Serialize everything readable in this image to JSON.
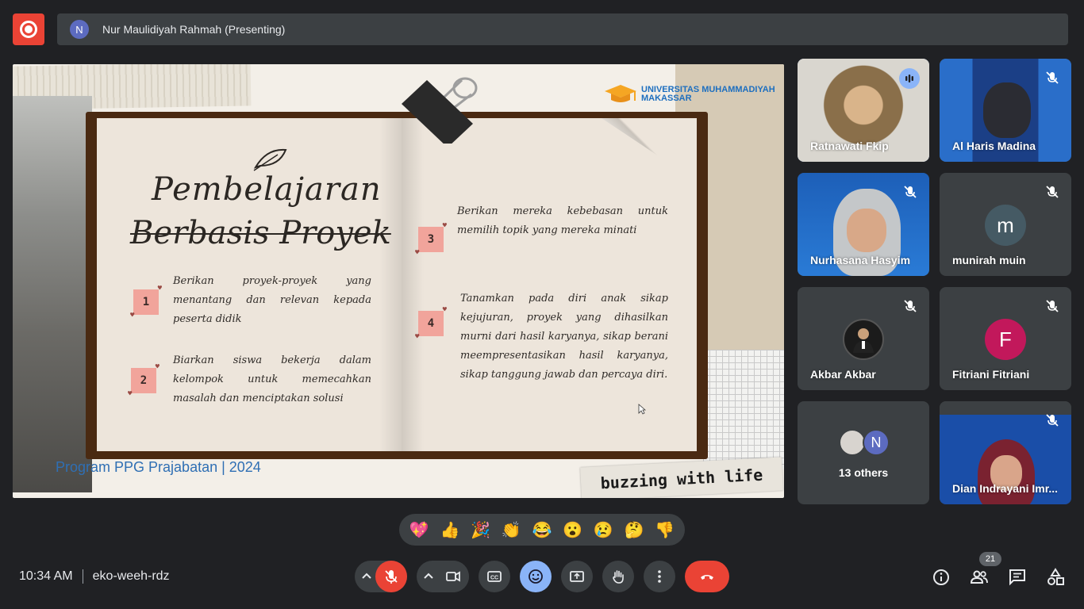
{
  "header": {
    "presenter_initial": "N",
    "presenter_label": "Nur Maulidiyah Rahmah (Presenting)"
  },
  "slide": {
    "logo_line1": "UNIVERSITAS MUHAMMADIYAH",
    "logo_line2": "MAKASSAR",
    "title_line1": "Pembelajaran",
    "title_line2": "Berbasis Proyek",
    "items": [
      {
        "num": "1",
        "text": "Berikan proyek-proyek yang menantang dan relevan kepada peserta didik"
      },
      {
        "num": "2",
        "text": "Biarkan siswa bekerja dalam kelompok untuk memecahkan masalah dan menciptakan solusi"
      },
      {
        "num": "3",
        "text": "Berikan mereka kebebasan untuk memilih topik yang mereka minati"
      },
      {
        "num": "4",
        "text": "Tanamkan pada diri anak sikap kejujuran, proyek yang dihasilkan murni dari hasil karyanya, sikap berani meempresentasikan hasil karyanya, sikap tanggung jawab dan percaya diri."
      }
    ],
    "footer": "Program PPG Prajabatan | 2024",
    "tape_text": "buzzing with life"
  },
  "participants": [
    {
      "name": "Ratnawati Fkip",
      "speaking": true
    },
    {
      "name": "Al Haris Madina",
      "muted": true
    },
    {
      "name": "Nurhasana Hasyim",
      "muted": true
    },
    {
      "name": "munirah muin",
      "initial": "m",
      "avatar_color": "#455a64",
      "muted": true
    },
    {
      "name": "Akbar Akbar",
      "muted": true
    },
    {
      "name": "Fitriani Fitriani",
      "initial": "F",
      "avatar_color": "#c2185b",
      "muted": true
    },
    {
      "name": "13 others",
      "initial": "N"
    },
    {
      "name": "Dian Indrayani Imr...",
      "muted": true
    }
  ],
  "reactions": [
    "💖",
    "👍",
    "🎉",
    "👏",
    "😂",
    "😮",
    "😢",
    "🤔",
    "👎"
  ],
  "footer_bar": {
    "time": "10:34 AM",
    "meeting_code": "eko-weeh-rdz",
    "participant_count": "21"
  },
  "colors": {
    "background": "#202124",
    "surface": "#3c4043",
    "danger": "#ea4335",
    "accent": "#8ab4f8"
  }
}
